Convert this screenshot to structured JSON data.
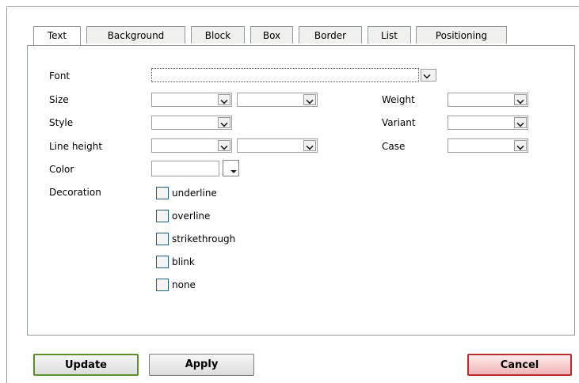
{
  "tabs": [
    "Text",
    "Background",
    "Block",
    "Box",
    "Border",
    "List",
    "Positioning"
  ],
  "active_tab": "Text",
  "labels": {
    "font": "Font",
    "size": "Size",
    "style": "Style",
    "line_height": "Line height",
    "color": "Color",
    "decoration": "Decoration",
    "weight": "Weight",
    "variant": "Variant",
    "case": "Case"
  },
  "decorations": [
    "underline",
    "overline",
    "strikethrough",
    "blink",
    "none"
  ],
  "buttons": {
    "update": "Update",
    "apply": "Apply",
    "cancel": "Cancel"
  },
  "colors": {
    "update_border": "#5c8e2a",
    "cancel_border": "#b52f2f"
  }
}
